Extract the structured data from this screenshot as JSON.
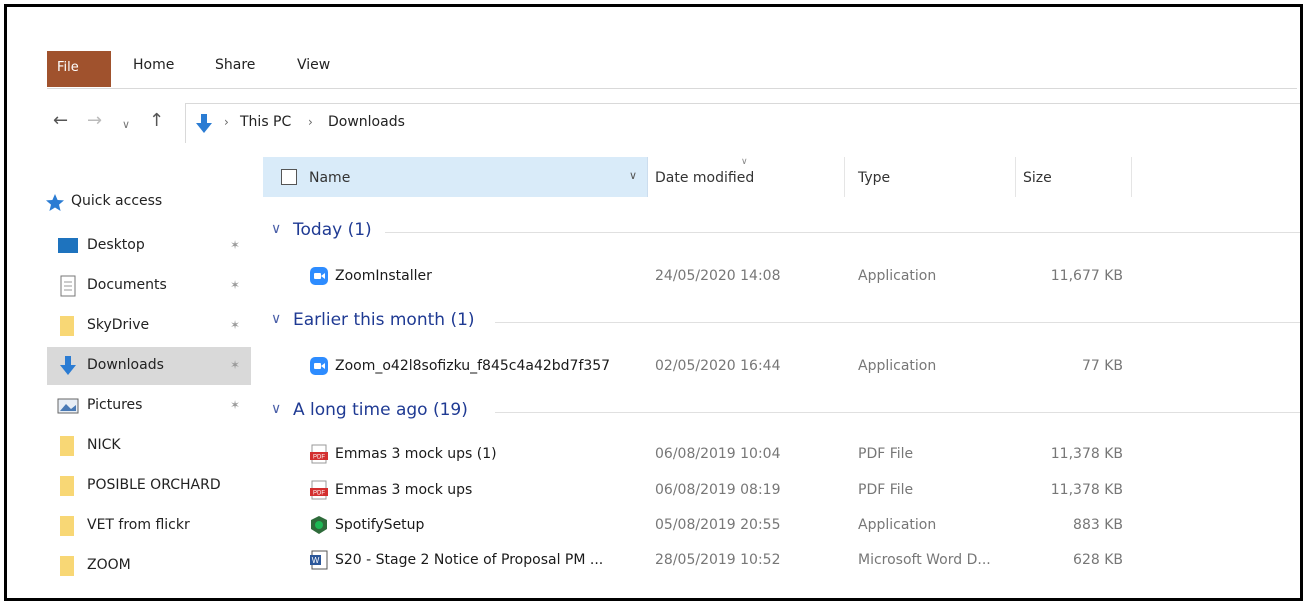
{
  "ribbon": {
    "tabs": [
      {
        "label": "File"
      },
      {
        "label": "Home"
      },
      {
        "label": "Share"
      },
      {
        "label": "View"
      }
    ]
  },
  "address": {
    "crumbs": [
      "This PC",
      "Downloads"
    ]
  },
  "nav_pane": {
    "quick_access": "Quick access",
    "items": [
      {
        "label": "Desktop",
        "icon": "desktop-icon",
        "pinned": true
      },
      {
        "label": "Documents",
        "icon": "documents-icon",
        "pinned": true
      },
      {
        "label": "SkyDrive",
        "icon": "folder-icon",
        "pinned": true
      },
      {
        "label": "Downloads",
        "icon": "downloads-icon",
        "pinned": true,
        "selected": true
      },
      {
        "label": "Pictures",
        "icon": "pictures-icon",
        "pinned": true
      },
      {
        "label": "NICK",
        "icon": "folder-icon"
      },
      {
        "label": "POSIBLE ORCHARD",
        "icon": "folder-icon"
      },
      {
        "label": "VET from flickr",
        "icon": "folder-icon"
      },
      {
        "label": "ZOOM",
        "icon": "folder-icon"
      }
    ]
  },
  "columns": {
    "name": "Name",
    "date": "Date modified",
    "type": "Type",
    "size": "Size"
  },
  "groups": [
    {
      "label": "Today (1)"
    },
    {
      "label": "Earlier this month (1)"
    },
    {
      "label": "A long time ago (19)"
    }
  ],
  "files": [
    {
      "name": "ZoomInstaller",
      "date": "24/05/2020 14:08",
      "type": "Application",
      "size": "11,677 KB",
      "icon": "zoom-icon"
    },
    {
      "name": "Zoom_o42l8sofizku_f845c4a42bd7f357",
      "date": "02/05/2020 16:44",
      "type": "Application",
      "size": "77 KB",
      "icon": "zoom-icon"
    },
    {
      "name": "Emmas 3  mock ups (1)",
      "date": "06/08/2019 10:04",
      "type": "PDF File",
      "size": "11,378 KB",
      "icon": "pdf-icon"
    },
    {
      "name": "Emmas 3  mock ups",
      "date": "06/08/2019 08:19",
      "type": "PDF File",
      "size": "11,378 KB",
      "icon": "pdf-icon"
    },
    {
      "name": "SpotifySetup",
      "date": "05/08/2019 20:55",
      "type": "Application",
      "size": "883 KB",
      "icon": "spotify-icon"
    },
    {
      "name": "S20 - Stage 2 Notice of Proposal PM ...",
      "date": "28/05/2019 10:52",
      "type": "Microsoft Word D...",
      "size": "628 KB",
      "icon": "word-icon"
    }
  ],
  "colors": {
    "file_tab": "#a0522d",
    "group_label": "#1f3a93",
    "selected_nav": "#d9d9d9",
    "name_header": "#d9ebf9"
  }
}
